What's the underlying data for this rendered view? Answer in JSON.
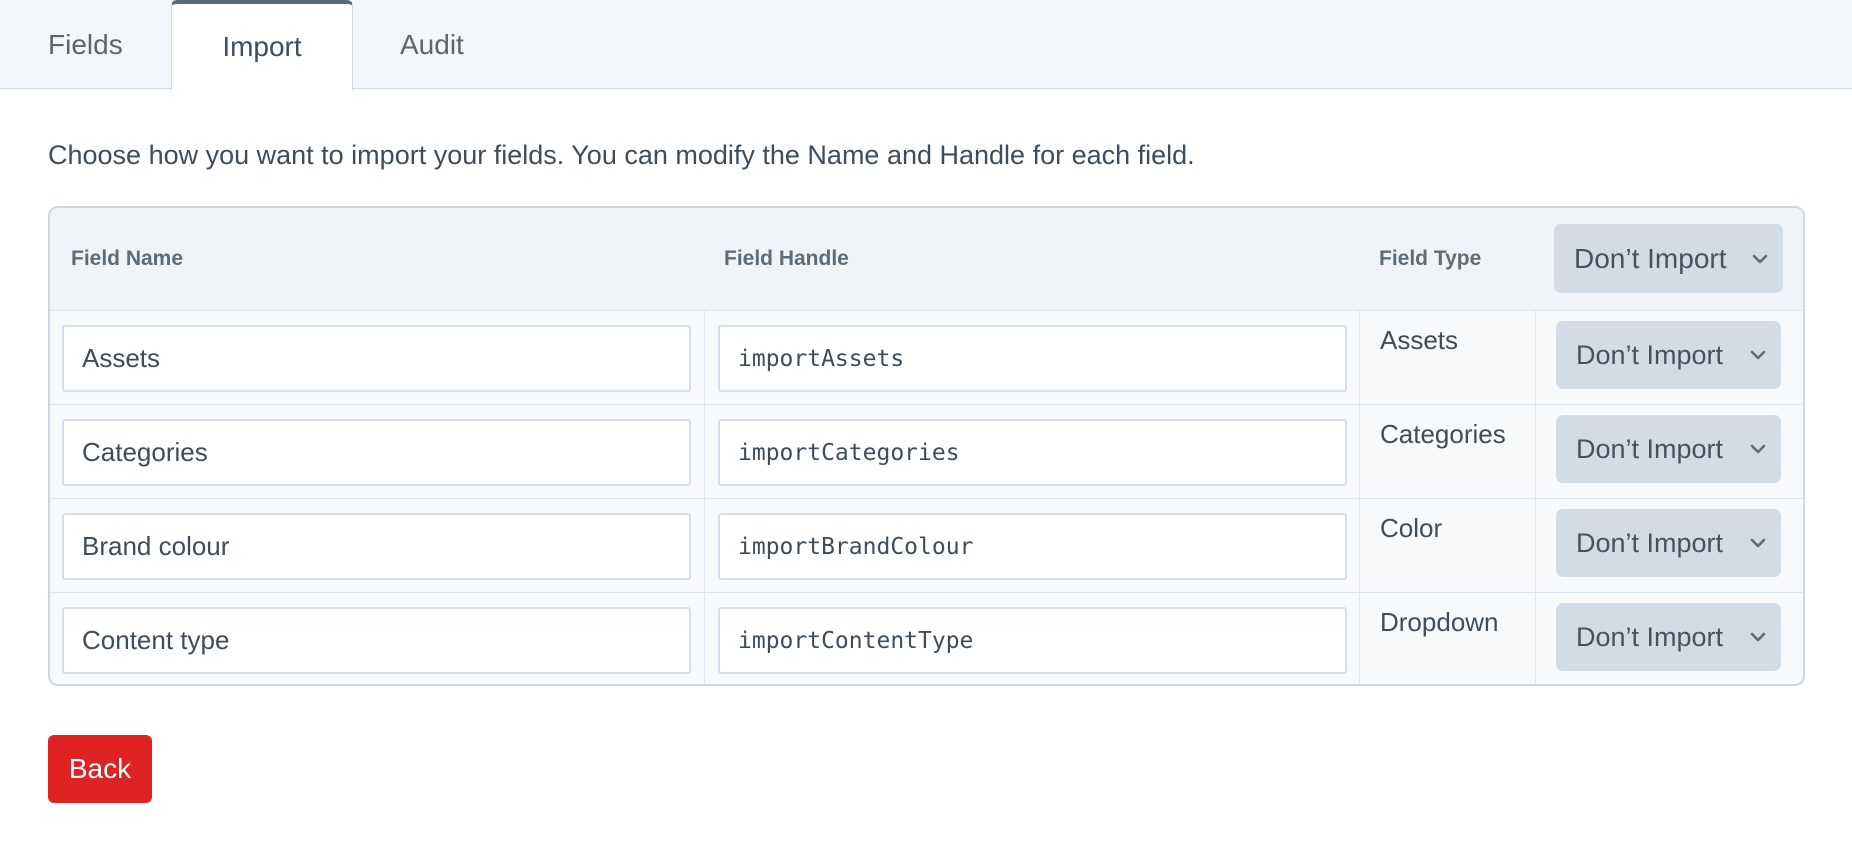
{
  "tabs": [
    {
      "label": "Fields"
    },
    {
      "label": "Import",
      "active": true
    },
    {
      "label": "Audit"
    }
  ],
  "instructions": "Choose how you want to import your fields. You can modify the Name and Handle for each field.",
  "table": {
    "headers": {
      "name": "Field Name",
      "handle": "Field Handle",
      "type": "Field Type",
      "bulk_action": "Don’t Import"
    },
    "rows": [
      {
        "name": "Assets",
        "handle": "importAssets",
        "type": "Assets",
        "action": "Don’t Import"
      },
      {
        "name": "Categories",
        "handle": "importCategories",
        "type": "Categories",
        "action": "Don’t Import"
      },
      {
        "name": "Brand colour",
        "handle": "importBrandColour",
        "type": "Color",
        "action": "Don’t Import"
      },
      {
        "name": "Content type",
        "handle": "importContentType",
        "type": "Dropdown",
        "action": "Don’t Import"
      }
    ]
  },
  "back_button": {
    "label": "Back"
  },
  "icons": {
    "select_chevron": "chevron-down-icon"
  },
  "colors": {
    "accent_danger": "#df2323",
    "tab_active_border": "#5b6a79",
    "select_bg": "#d3dce6",
    "header_bg": "#f0f4f9"
  }
}
